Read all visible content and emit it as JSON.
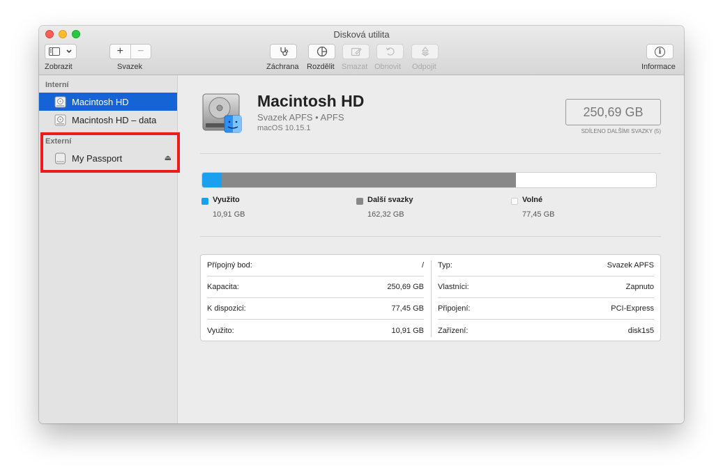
{
  "window": {
    "title": "Disková utilita"
  },
  "toolbar": {
    "view_label": "Zobrazit",
    "volume_label": "Svazek",
    "first_aid_label": "Záchrana",
    "partition_label": "Rozdělit",
    "erase_label": "Smazat",
    "restore_label": "Obnovit",
    "unmount_label": "Odpojit",
    "info_label": "Informace",
    "volume_add_glyph": "+",
    "volume_remove_glyph": "−",
    "info_glyph": "i"
  },
  "sidebar": {
    "internal_header": "Interní",
    "external_header": "Externí",
    "internal_items": [
      {
        "label": "Macintosh HD",
        "icon": "internal-disk-icon",
        "selected": true
      },
      {
        "label": "Macintosh HD – data",
        "icon": "internal-disk-icon",
        "selected": false
      }
    ],
    "external_items": [
      {
        "label": "My Passport",
        "icon": "external-disk-icon",
        "eject": "⏏"
      }
    ]
  },
  "volume": {
    "name": "Macintosh HD",
    "subtitle": "Svazek APFS • APFS",
    "os": "macOS 10.15.1",
    "capacity": "250,69 GB",
    "capacity_note": "SDÍLENO DALŠÍMI SVAZKY (5)"
  },
  "usage": {
    "total_gb": 250.69,
    "segments": [
      {
        "name": "Využito",
        "value": "10,91 GB",
        "gb": 10.91,
        "color": "#1aa0ee"
      },
      {
        "name": "Další svazky",
        "value": "162,32 GB",
        "gb": 162.32,
        "color": "#888888"
      },
      {
        "name": "Volné",
        "value": "77,45 GB",
        "gb": 77.45,
        "color": "#ffffff"
      }
    ]
  },
  "info": {
    "left": [
      {
        "label": "Přípojný bod:",
        "value": "/"
      },
      {
        "label": "Kapacita:",
        "value": "250,69 GB"
      },
      {
        "label": "K dispozici:",
        "value": "77,45 GB"
      },
      {
        "label": "Využito:",
        "value": "10,91 GB"
      }
    ],
    "right": [
      {
        "label": "Typ:",
        "value": "Svazek APFS"
      },
      {
        "label": "Vlastníci:",
        "value": "Zapnuto"
      },
      {
        "label": "Připojení:",
        "value": "PCI-Express"
      },
      {
        "label": "Zařízení:",
        "value": "disk1s5"
      }
    ]
  },
  "colors": {
    "accent": "#1464d6",
    "highlight": "#ec1c1c"
  }
}
